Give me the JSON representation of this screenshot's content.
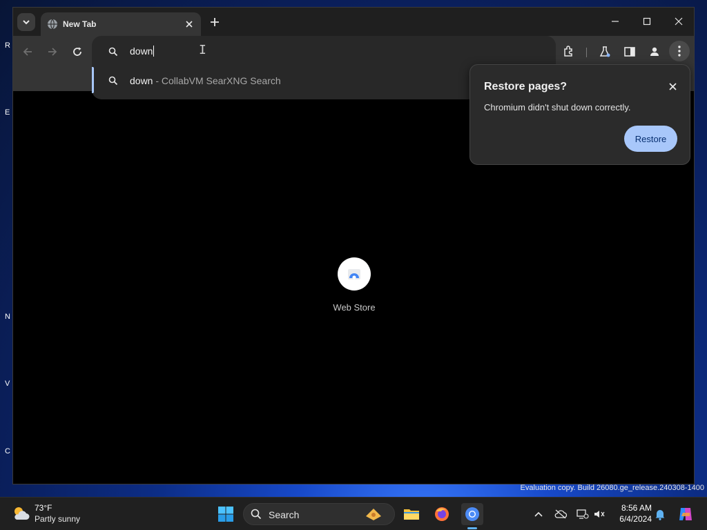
{
  "browser": {
    "tab": {
      "title": "New Tab"
    },
    "omnibox": {
      "text": "down"
    },
    "suggestion": {
      "query": "down",
      "description": " - CollabVM SearXNG Search"
    },
    "restore_bubble": {
      "title": "Restore pages?",
      "message": "Chromium didn't shut down correctly.",
      "button": "Restore"
    },
    "shortcut": {
      "label": "Web Store"
    }
  },
  "desktop": {
    "icon_letters": [
      "R",
      "E",
      "N",
      "V",
      "C"
    ],
    "watermark": "Evaluation copy. Build 26080.ge_release.240308-1400"
  },
  "taskbar": {
    "weather": {
      "temp": "73°F",
      "condition": "Partly sunny"
    },
    "search_label": "Search",
    "clock": {
      "time": "8:56 AM",
      "date": "6/4/2024"
    }
  },
  "colors": {
    "accent": "#a8c7fa",
    "window_frame": "#1f1f1f",
    "toolbar": "#353535",
    "omnibox": "#282828"
  }
}
